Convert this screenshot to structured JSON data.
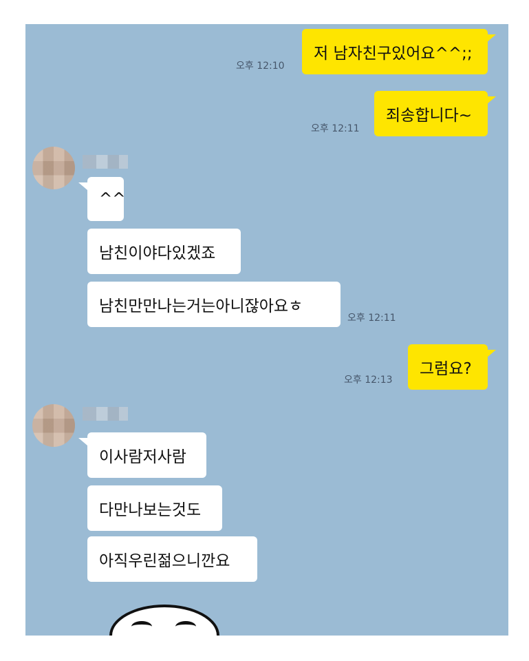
{
  "messages": [
    {
      "text": "저 남자친구있어요^^;;",
      "time": "오후 12:10"
    },
    {
      "text": "죄송합니다~",
      "time": "오후 12:11"
    },
    {
      "text": "^^"
    },
    {
      "text": "남친이야다있겠죠"
    },
    {
      "text": "남친만만나는거는아니잖아요ㅎ",
      "time": "오후 12:11"
    },
    {
      "text": "그럼요?",
      "time": "오후 12:13"
    },
    {
      "text": "이사람저사람"
    },
    {
      "text": "다만나보는것도"
    },
    {
      "text": "아직우린젊으니깐요"
    }
  ],
  "colors": {
    "chat_background": "#9bbbd4",
    "my_bubble": "#fee500",
    "their_bubble": "#ffffff"
  },
  "icons": {
    "avatar": "blurred-profile-avatar",
    "sticker": "face-emoticon-sticker"
  }
}
